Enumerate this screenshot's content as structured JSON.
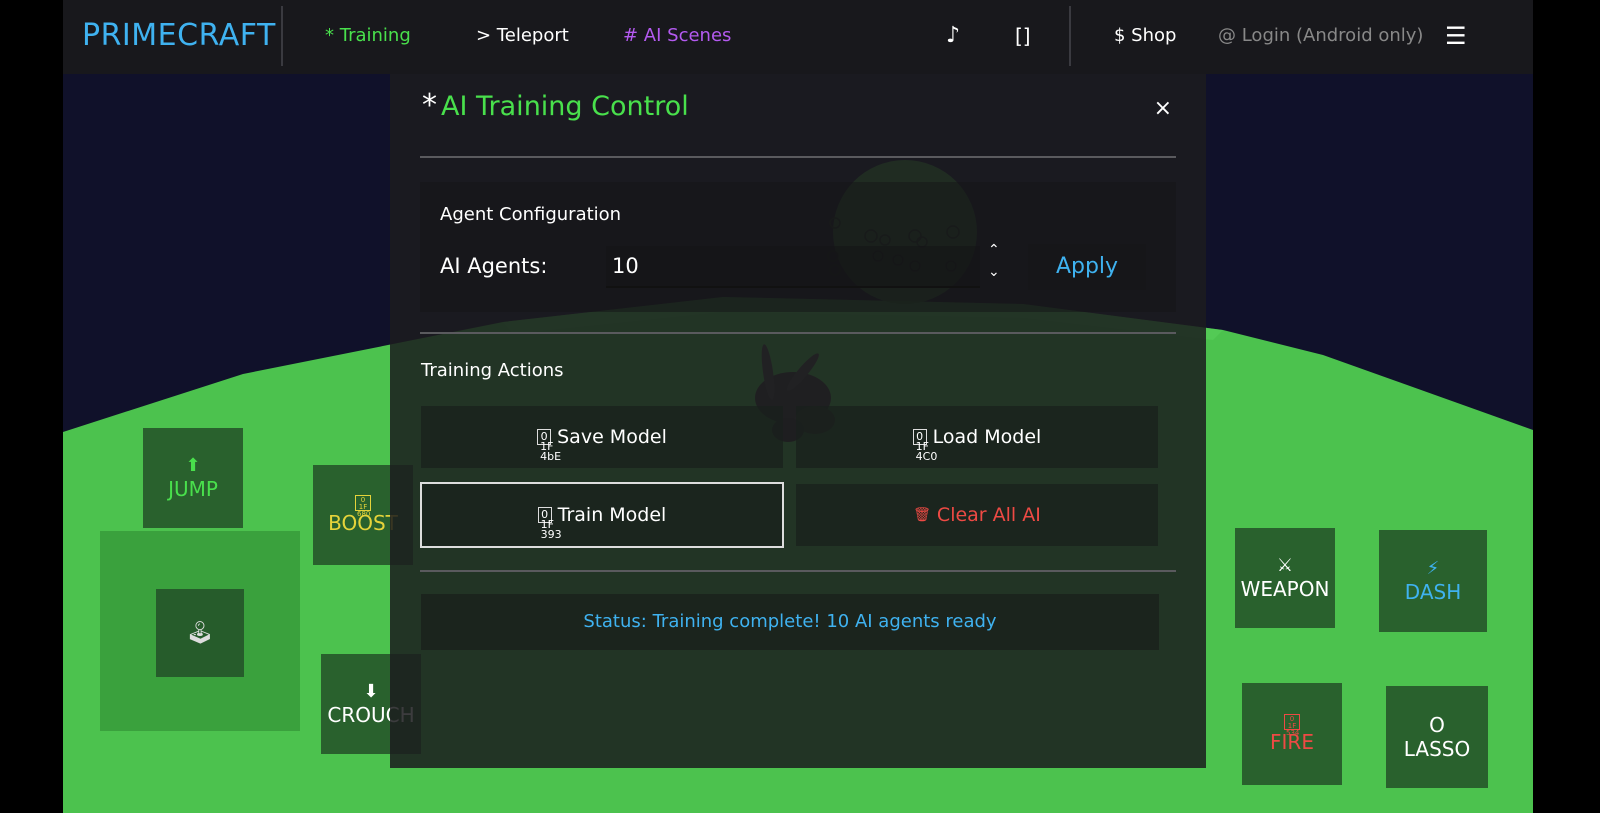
{
  "app": {
    "logo": "PRIMECRAFT",
    "nav": {
      "training": "* Training",
      "teleport": "> Teleport",
      "ai_scenes": "# AI Scenes",
      "music_icon": "♪",
      "fullscreen_icon": "[]",
      "shop": "$ Shop",
      "login": "@ Login (Android only)",
      "menu_icon": "☰"
    },
    "colors": {
      "accent_blue": "#3fb2f0",
      "accent_green": "#49e04c",
      "scenes_purple": "#b45af0",
      "danger_red": "#ee4a44",
      "yellow": "#e5d33a"
    }
  },
  "modal": {
    "title_prefix": "*",
    "title": "AI Training Control",
    "close": "×",
    "agent_config": {
      "heading": "Agent Configuration",
      "agents_label": "AI Agents:",
      "agents_value": "10",
      "spin_up": "⌃",
      "spin_down": "⌄",
      "apply": "Apply"
    },
    "training_actions": {
      "heading": "Training Actions",
      "save": "Save Model",
      "save_icon": "0 1F 4bE",
      "load": "Load Model",
      "load_icon": "0 1F 4C0",
      "train": "Train Model",
      "train_icon": "0 1F 393",
      "clear": "Clear All AI",
      "clear_icon": "🗑"
    },
    "status": "Status: Training complete! 10 AI agents ready"
  },
  "controls": {
    "jump": {
      "icon": "⬆",
      "label": "JUMP"
    },
    "boost": {
      "icon": "0 1F 680",
      "label": "BOOST"
    },
    "crouch": {
      "icon": "⬇",
      "label": "CROUCH"
    },
    "joystick_icon": "🕹",
    "weapon": {
      "icon": "⚔",
      "label": "WEAPON"
    },
    "dash": {
      "icon": "⚡",
      "label": "DASH"
    },
    "fire": {
      "icon": "0 1F 534",
      "label": "FIRE"
    },
    "lasso": {
      "icon": "O",
      "label": "LASSO"
    }
  }
}
